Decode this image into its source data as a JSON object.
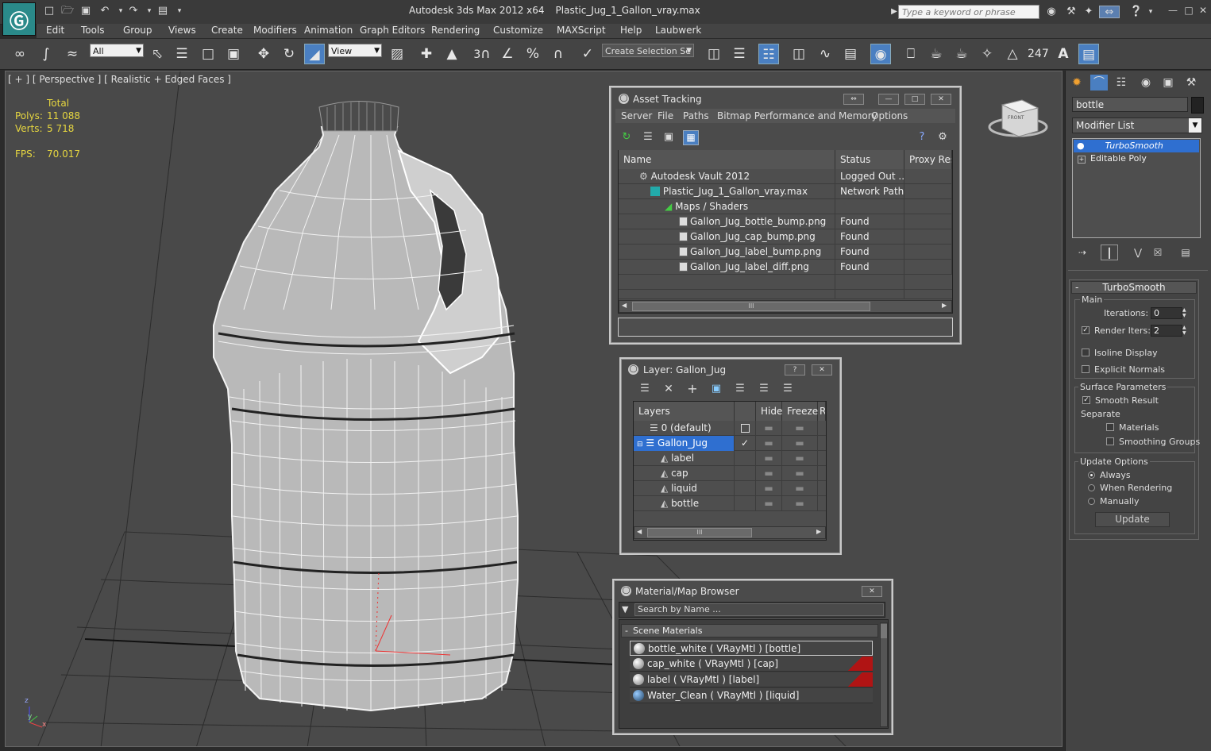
{
  "titlebar": {
    "app": "Autodesk 3ds Max  2012 x64",
    "file": "Plastic_Jug_1_Gallon_vray.max",
    "search_placeholder": "Type a keyword or phrase"
  },
  "menu": [
    "Edit",
    "Tools",
    "Group",
    "Views",
    "Create",
    "Modifiers",
    "Animation",
    "Graph Editors",
    "Rendering",
    "Customize",
    "MAXScript",
    "Help",
    "Laubwerk"
  ],
  "toolbar": {
    "filter_value": "All",
    "refcoord_value": "View",
    "angle_snap": "3",
    "selection_set_placeholder": "Create Selection Se",
    "counter": "247"
  },
  "viewport": {
    "label": "[ + ] [ Perspective ] [ Realistic + Edged Faces ]",
    "stats": {
      "total_label": "Total",
      "polys_label": "Polys:",
      "polys_value": "11 088",
      "verts_label": "Verts:",
      "verts_value": "5 718",
      "fps_label": "FPS:",
      "fps_value": "70.017"
    },
    "viewcube_label": "FRONT",
    "axis_z": "z",
    "axis_x": "x",
    "axis_y": "y"
  },
  "command_panel": {
    "object_name": "bottle",
    "modifier_list_label": "Modifier List",
    "stack": [
      "TurboSmooth",
      "Editable Poly"
    ],
    "rollout_title": "TurboSmooth",
    "main_group": "Main",
    "iterations_label": "Iterations:",
    "iterations_value": "0",
    "render_iters_label": "Render Iters:",
    "render_iters_value": "2",
    "isoline_label": "Isoline Display",
    "explicit_normals_label": "Explicit Normals",
    "surface_group": "Surface Parameters",
    "smooth_result_label": "Smooth Result",
    "separate_label": "Separate",
    "materials_label": "Materials",
    "smoothing_groups_label": "Smoothing Groups",
    "update_group": "Update Options",
    "always_label": "Always",
    "when_rendering_label": "When Rendering",
    "manually_label": "Manually",
    "update_button": "Update"
  },
  "asset_tracking": {
    "title": "Asset Tracking",
    "menu": [
      "Server",
      "File",
      "Paths",
      "Bitmap Performance and Memory",
      "Options"
    ],
    "columns": [
      "Name",
      "Status",
      "Proxy Reso"
    ],
    "rows": [
      {
        "name": "Autodesk Vault 2012",
        "status": "Logged Out ..."
      },
      {
        "name": "Plastic_Jug_1_Gallon_vray.max",
        "status": "Network Path"
      },
      {
        "name": "Maps / Shaders",
        "status": ""
      },
      {
        "name": "Gallon_Jug_bottle_bump.png",
        "status": "Found"
      },
      {
        "name": "Gallon_Jug_cap_bump.png",
        "status": "Found"
      },
      {
        "name": "Gallon_Jug_label_bump.png",
        "status": "Found"
      },
      {
        "name": "Gallon_Jug_label_diff.png",
        "status": "Found"
      }
    ],
    "scroll_grip": "III"
  },
  "layer_window": {
    "title": "Layer: Gallon_Jug",
    "columns": [
      "Layers",
      "Hide",
      "Freeze",
      "R"
    ],
    "rows": [
      {
        "name": "0 (default)"
      },
      {
        "name": "Gallon_Jug"
      },
      {
        "name": "label"
      },
      {
        "name": "cap"
      },
      {
        "name": "liquid"
      },
      {
        "name": "bottle"
      }
    ],
    "scroll_grip": "III",
    "help_btn": "?"
  },
  "material_browser": {
    "title": "Material/Map Browser",
    "search_placeholder": "Search by Name ...",
    "group": "Scene Materials",
    "group_toggle": "-",
    "items": [
      "bottle_white  ( VRayMtl )  [bottle]",
      "cap_white  ( VRayMtl )  [cap]",
      "label  ( VRayMtl )  [label]",
      "Water_Clean  ( VRayMtl )  [liquid]"
    ]
  },
  "colors": {
    "highlight": "#2f6fd0",
    "stat_yellow": "#e6d640",
    "red_swatch": "#b01414"
  }
}
